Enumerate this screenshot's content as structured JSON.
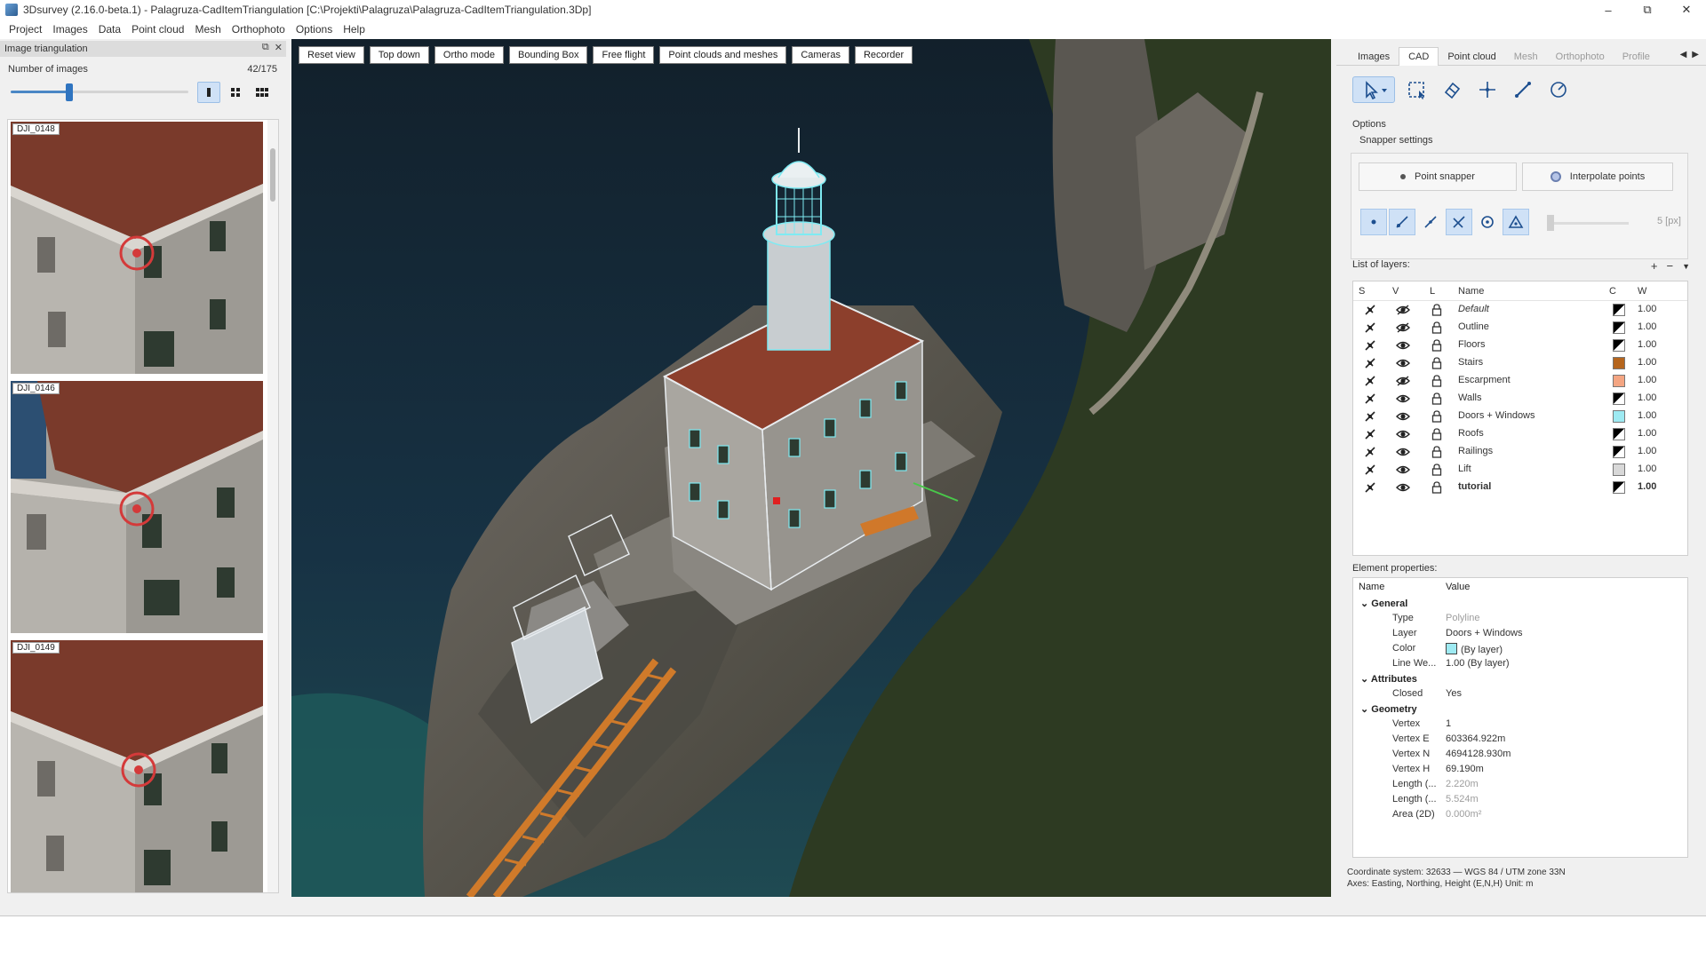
{
  "window": {
    "title": "3Dsurvey (2.16.0-beta.1) - Palagruza-CadItemTriangulation [C:\\Projekti\\Palagruza\\Palagruza-CadItemTriangulation.3Dp]",
    "controls": [
      "–",
      "⧉",
      "✕"
    ]
  },
  "menu": [
    "Project",
    "Images",
    "Data",
    "Point cloud",
    "Mesh",
    "Orthophoto",
    "Options",
    "Help"
  ],
  "left_panel": {
    "title": "Image triangulation",
    "num_images_label": "Number of images",
    "num_images_value": "42/175",
    "slider_fraction": 0.33,
    "thumbnails": [
      "DJI_0148",
      "DJI_0146",
      "DJI_0149"
    ]
  },
  "viewport": {
    "toolbar": [
      "Reset view",
      "Top down",
      "Ortho mode",
      "Bounding Box",
      "Free flight",
      "Point clouds and meshes",
      "Cameras",
      "Recorder"
    ]
  },
  "right_panel": {
    "tabs": [
      {
        "label": "Images",
        "state": "normal"
      },
      {
        "label": "CAD",
        "state": "active"
      },
      {
        "label": "Point cloud",
        "state": "normal"
      },
      {
        "label": "Mesh",
        "state": "dim"
      },
      {
        "label": "Orthophoto",
        "state": "dim"
      },
      {
        "label": "Profile",
        "state": "dim"
      }
    ],
    "options_label": "Options",
    "snapper_label": "Snapper settings",
    "point_snapper": "Point snapper",
    "interpolate_points": "Interpolate points",
    "snap_size": "5 [px]",
    "layers_label": "List of layers:",
    "layer_columns": {
      "s": "S",
      "v": "V",
      "l": "L",
      "name": "Name",
      "c": "C",
      "w": "W"
    },
    "layers": [
      {
        "name": "Default",
        "color": "#000000",
        "w": "1.00",
        "visible": false,
        "italic": true,
        "bold": false
      },
      {
        "name": "Outline",
        "color": "#000000",
        "w": "1.00",
        "visible": false,
        "italic": false,
        "bold": false
      },
      {
        "name": "Floors",
        "color": "#000000",
        "w": "1.00",
        "visible": true,
        "italic": false,
        "bold": false
      },
      {
        "name": "Stairs",
        "color": "#b5651d",
        "w": "1.00",
        "visible": true,
        "italic": false,
        "bold": false
      },
      {
        "name": "Escarpment",
        "color": "#f4a582",
        "w": "1.00",
        "visible": false,
        "italic": false,
        "bold": false
      },
      {
        "name": "Walls",
        "color": "#000000",
        "w": "1.00",
        "visible": true,
        "italic": false,
        "bold": false
      },
      {
        "name": "Doors + Windows",
        "color": "#9eeaf2",
        "w": "1.00",
        "visible": true,
        "italic": false,
        "bold": false
      },
      {
        "name": "Roofs",
        "color": "#000000",
        "w": "1.00",
        "visible": true,
        "italic": false,
        "bold": false
      },
      {
        "name": "Railings",
        "color": "#000000",
        "w": "1.00",
        "visible": true,
        "italic": false,
        "bold": false
      },
      {
        "name": "Lift",
        "color": "#d8d8d8",
        "w": "1.00",
        "visible": true,
        "italic": false,
        "bold": false
      },
      {
        "name": "tutorial",
        "color": "#000000",
        "w": "1.00",
        "visible": true,
        "italic": false,
        "bold": true
      }
    ],
    "props_label": "Element properties:",
    "props_columns": {
      "name": "Name",
      "value": "Value"
    },
    "props": [
      {
        "group": "General"
      },
      {
        "name": "Type",
        "value": "Polyline",
        "dim": true
      },
      {
        "name": "Layer",
        "value": "Doors + Windows"
      },
      {
        "name": "Color",
        "value": "(By layer)",
        "swatch": "#9eeaf2"
      },
      {
        "name": "Line We...",
        "value": "1.00 (By layer)"
      },
      {
        "group": "Attributes"
      },
      {
        "name": "Closed",
        "value": "Yes"
      },
      {
        "group": "Geometry"
      },
      {
        "name": "Vertex",
        "value": "1"
      },
      {
        "name": "Vertex E",
        "value": "603364.922m"
      },
      {
        "name": "Vertex N",
        "value": "4694128.930m"
      },
      {
        "name": "Vertex H",
        "value": "69.190m"
      },
      {
        "name": "Length (...",
        "value": "2.220m",
        "dim": true
      },
      {
        "name": "Length (...",
        "value": "5.524m",
        "dim": true
      },
      {
        "name": "Area (2D)",
        "value": "0.000m²",
        "dim": true
      }
    ],
    "coord_line1": "Coordinate system: 32633 — WGS 84 / UTM zone 33N",
    "coord_line2": "Axes: Easting, Northing, Height (E,N,H) Unit: m"
  }
}
